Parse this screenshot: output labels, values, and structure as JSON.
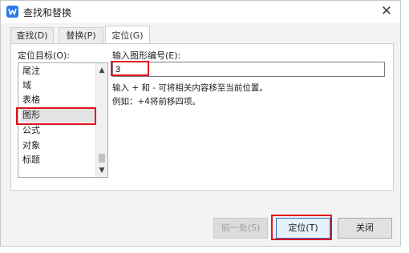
{
  "window": {
    "title": "查找和替换",
    "icon": "wps-writer-icon",
    "close_glyph": "✕"
  },
  "tabs": [
    {
      "label": "查找(D)"
    },
    {
      "label": "替换(P)"
    },
    {
      "label": "定位(G)",
      "active": true
    }
  ],
  "goto": {
    "target_label": "定位目标(O):",
    "targets": [
      "尾注",
      "域",
      "表格",
      "图形",
      "公式",
      "对象",
      "标题"
    ],
    "selected_target": "图形",
    "input_label": "输入图形编号(E):",
    "input_value": "3",
    "hint_line1": "输入 + 和 - 可将相关内容移至当前位置。",
    "hint_line2": "例如：+4将前移四项。"
  },
  "buttons": {
    "previous": "前一处(S)",
    "goto": "定位(T)",
    "close": "关闭"
  },
  "colors": {
    "highlight": "#e0141d",
    "icon_blue": "#2b79e6"
  }
}
